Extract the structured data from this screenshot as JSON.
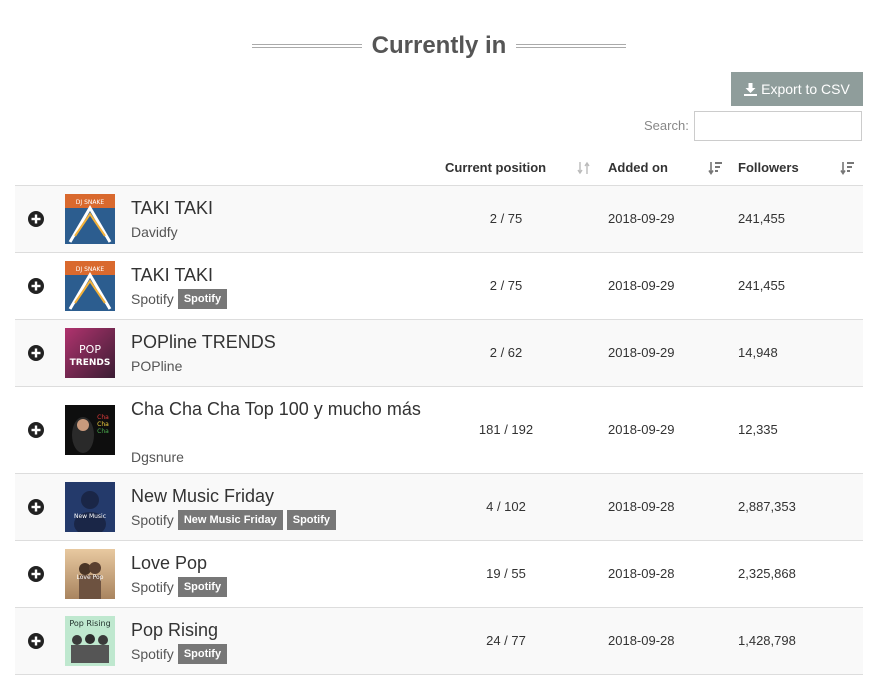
{
  "header": {
    "title": "Currently in",
    "export_label": "Export to CSV",
    "search_label": "Search:",
    "search_value": ""
  },
  "columns": {
    "position": "Current position",
    "added": "Added on",
    "followers": "Followers"
  },
  "colors": {
    "export_button": "#8f9d9b",
    "tag": "#777777",
    "row_alt": "#f9f9f9"
  },
  "rows": [
    {
      "title": "TAKI TAKI",
      "owner": "Davidfy",
      "tags": [],
      "position": "2 / 75",
      "added": "2018-09-29",
      "followers": "241,455",
      "cover": "taki-taki-cover"
    },
    {
      "title": "TAKI TAKI",
      "owner": "Spotify",
      "tags": [
        "Spotify"
      ],
      "position": "2 / 75",
      "added": "2018-09-29",
      "followers": "241,455",
      "cover": "taki-taki-cover"
    },
    {
      "title": "POPline TRENDS",
      "owner": "POPline",
      "tags": [],
      "position": "2 / 62",
      "added": "2018-09-29",
      "followers": "14,948",
      "cover": "popline-trends-cover"
    },
    {
      "title": "Cha Cha Cha Top 100 y mucho más",
      "owner": "Dgsnure",
      "tags": [],
      "position": "181 / 192",
      "added": "2018-09-29",
      "followers": "12,335",
      "cover": "cha-cha-cha-cover"
    },
    {
      "title": "New Music Friday",
      "owner": "Spotify",
      "tags": [
        "New Music Friday",
        "Spotify"
      ],
      "position": "4 / 102",
      "added": "2018-09-28",
      "followers": "2,887,353",
      "cover": "new-music-friday-cover"
    },
    {
      "title": "Love Pop",
      "owner": "Spotify",
      "tags": [
        "Spotify"
      ],
      "position": "19 / 55",
      "added": "2018-09-28",
      "followers": "2,325,868",
      "cover": "love-pop-cover"
    },
    {
      "title": "Pop Rising",
      "owner": "Spotify",
      "tags": [
        "Spotify"
      ],
      "position": "24 / 77",
      "added": "2018-09-28",
      "followers": "1,428,798",
      "cover": "pop-rising-cover"
    }
  ]
}
